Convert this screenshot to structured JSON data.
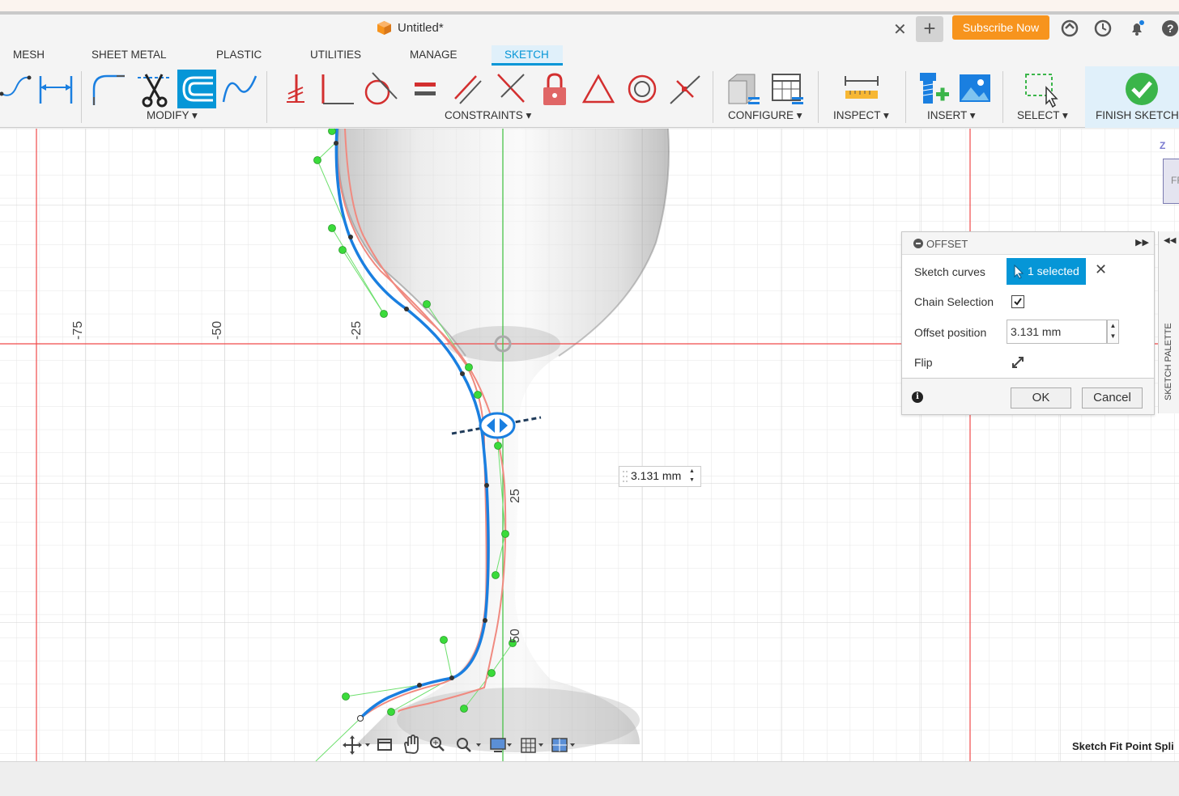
{
  "title_bar": {
    "document_title": "Untitled*",
    "subscribe_label": "Subscribe Now"
  },
  "ribbon_tabs": [
    "MESH",
    "SHEET METAL",
    "PLASTIC",
    "UTILITIES",
    "MANAGE",
    "SKETCH"
  ],
  "active_tab": "SKETCH",
  "ribbon_groups": {
    "modify": "MODIFY ▾",
    "constraints": "CONSTRAINTS ▾",
    "configure": "CONFIGURE ▾",
    "inspect": "INSPECT ▾",
    "insert": "INSERT ▾",
    "select": "SELECT ▾",
    "finish": "FINISH SKETCH"
  },
  "ruler_labels": {
    "h_neg75": "-75",
    "h_neg50": "-50",
    "h_neg25": "-25",
    "v_25": "25",
    "v_50": "50"
  },
  "offset_dialog": {
    "title": "OFFSET",
    "sketch_curves_label": "Sketch curves",
    "sketch_curves_value": "1 selected",
    "chain_selection_label": "Chain Selection",
    "chain_selection_checked": true,
    "offset_position_label": "Offset position",
    "offset_position_value": "3.131 mm",
    "flip_label": "Flip",
    "ok_label": "OK",
    "cancel_label": "Cancel"
  },
  "canvas_dimension_input": "3.131 mm",
  "sketch_palette_label": "SKETCH PALETTE",
  "viewcube": {
    "axis": "Z",
    "face": "FR"
  },
  "status_hint": "Sketch Fit Point Spli",
  "colors": {
    "accent": "#0696d7",
    "subscribe": "#f7941d",
    "curve_selected": "#1a7fe0",
    "curve_offset": "#f08a80",
    "axis_red": "#f04a4a",
    "axis_green": "#3cbf3c",
    "fit_point": "#3adb3a"
  }
}
